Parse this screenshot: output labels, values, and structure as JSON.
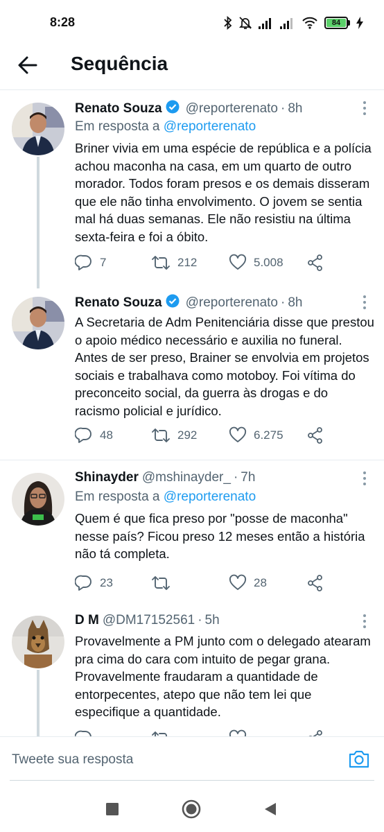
{
  "status_bar": {
    "time": "8:28",
    "battery": "84",
    "icons": [
      "bluetooth-icon",
      "mute-icon",
      "signal-icon",
      "signal-icon",
      "wifi-icon",
      "battery-icon",
      "charging-icon"
    ]
  },
  "app_bar": {
    "title": "Sequência",
    "back_icon": "arrow-left-icon"
  },
  "colors": {
    "accent": "#1d9bf0",
    "secondary_text": "#536471",
    "divider": "#e6ecf0"
  },
  "tweets": [
    {
      "name": "Renato Souza",
      "verified": true,
      "handle": "@reporterenato",
      "sep": "·",
      "time": "8h",
      "reply_prefix": "Em resposta a",
      "reply_to": "@reporterenato",
      "text": "Briner vivia em uma espécie de república e a polícia achou maconha na casa, em um quarto de outro morador. Todos foram presos e os demais disseram que ele não tinha envolvimento. O jovem se sentia mal há duas semanas. Ele não resistiu na última sexta-feira e foi a óbito.",
      "replies": "7",
      "retweets": "212",
      "likes": "5.008"
    },
    {
      "name": "Renato Souza",
      "verified": true,
      "handle": "@reporterenato",
      "sep": "·",
      "time": "8h",
      "text": "A Secretaria de Adm Penitenciária disse que prestou o apoio médico necessário e auxilia no funeral. Antes de ser preso, Brainer se envolvia em projetos sociais e trabalhava como motoboy. Foi vítima do preconceito social, da guerra às drogas e do racismo policial e jurídico.",
      "replies": "48",
      "retweets": "292",
      "likes": "6.275"
    },
    {
      "name": "Shinayder",
      "verified": false,
      "handle": "@mshinayder_",
      "sep": "·",
      "time": "7h",
      "reply_prefix": "Em resposta a",
      "reply_to": "@reporterenato",
      "text": "Quem é que fica preso por \"posse de maconha\" nesse país? Ficou preso 12 meses então a história não tá completa.",
      "replies": "23",
      "retweets": "",
      "likes": "28"
    },
    {
      "name": "D M",
      "verified": false,
      "handle": "@DM17152561",
      "sep": "·",
      "time": "5h",
      "text": "Provavelmente a PM junto com o delegado atearam pra cima do cara com intuito de pegar grana. Provavelmente fraudaram a quantidade de entorpecentes, atepo que não tem lei que especifique a quantidade."
    }
  ],
  "compose": {
    "placeholder": "Tweete sua resposta",
    "camera_icon": "camera-icon"
  },
  "nav_bar": {
    "icons": [
      "recents-square-icon",
      "home-circle-icon",
      "back-triangle-icon"
    ]
  }
}
